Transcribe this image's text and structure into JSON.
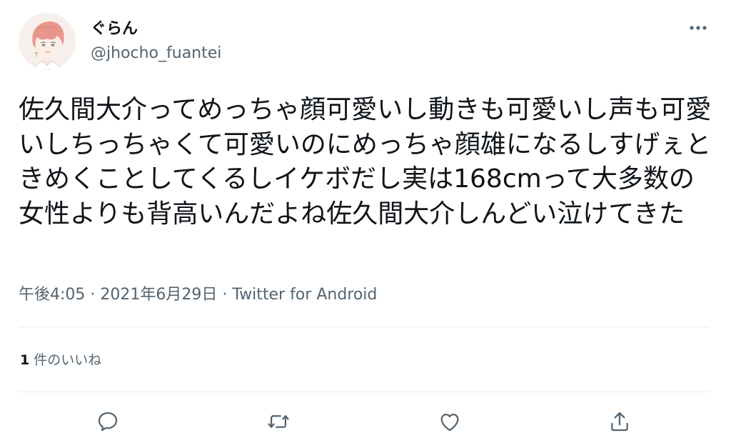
{
  "user": {
    "display_name": "ぐらん",
    "handle": "@jhocho_fuantei",
    "avatar_icon": "avatar-illustration"
  },
  "tweet": {
    "text": "佐久間大介ってめっちゃ顔可愛いし動きも可愛いし声も可愛いしちっちゃくて可愛いのにめっちゃ顔雄になるしすげぇときめくことしてくるしイケボだし実は168cmって大多数の女性よりも背高いんだよね佐久間大介しんどい泣けてきた",
    "time": "午後4:05",
    "separator": " · ",
    "date": "2021年6月29日",
    "source": "Twitter for Android"
  },
  "stats": {
    "likes_count": "1",
    "likes_label": "件のいいね"
  },
  "actions": [
    {
      "name": "reply",
      "icon": "reply-icon"
    },
    {
      "name": "retweet",
      "icon": "retweet-icon"
    },
    {
      "name": "like",
      "icon": "heart-icon"
    },
    {
      "name": "share",
      "icon": "share-icon"
    }
  ],
  "colors": {
    "text": "#0f1419",
    "secondary": "#536471",
    "divider": "#e6ecf0",
    "avatar_hair": "#e89a90"
  }
}
